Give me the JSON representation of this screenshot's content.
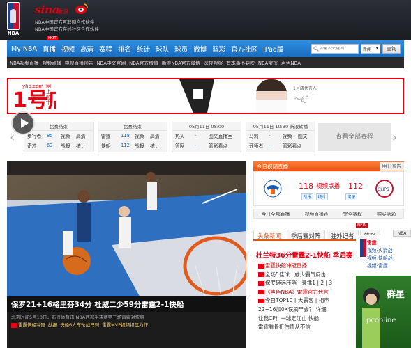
{
  "header": {
    "nba_word": "NBA",
    "sina": "sina",
    "sina_sub": "新浪",
    "partner_line1": "NBA中国官方互联网合作伙伴",
    "partner_line2": "NBA中国官方在线社区合作伙伴",
    "nav_hot": "HOT",
    "nav": [
      "My NBA",
      "直播",
      "视频",
      "高清",
      "赛程",
      "排名",
      "统计",
      "球队",
      "球员",
      "微博",
      "篮彩",
      "官方社区",
      "iPad版"
    ],
    "search_placeholder": "请输入关键词",
    "search_select": "新闻",
    "search_button": "查询",
    "subnav": [
      "NBA视频直播",
      "视频点播",
      "电视直播预告",
      "NBA中文官网",
      "NBA官方增值",
      "新浪NBA官方微博",
      "深夜视察",
      "有本事不要吹",
      "NBA宝探",
      "声色NBA"
    ]
  },
  "banner": {
    "yhd_url": "yhd.com",
    "yhd_cn1": "1号店",
    "yhd_tag": "网上超市",
    "spokes_label": "1号店代言人"
  },
  "schedule": {
    "games": [
      {
        "head": "比赛结束",
        "rows": [
          [
            "步行者",
            "85",
            "视频",
            "高清"
          ],
          [
            "奇才",
            "63",
            "战报",
            "统计"
          ]
        ]
      },
      {
        "head": "比赛结束",
        "rows": [
          [
            "雷霆",
            "118",
            "视频",
            "高清"
          ],
          [
            "快船",
            "112",
            "战报",
            "统计"
          ]
        ]
      },
      {
        "head": "05月11日 08:00",
        "rows": [
          [
            "热火",
            "-",
            "图文直播室",
            ""
          ],
          [
            "篮网",
            "-",
            "篮彩看点",
            ""
          ]
        ]
      },
      {
        "head": "05月11日 10:30 新浪转播",
        "rows": [
          [
            "马刺",
            "-",
            "视频",
            "图文"
          ],
          [
            "开拓者",
            "-",
            "篮彩看点",
            ""
          ]
        ]
      }
    ],
    "all_button": "查看全部赛程"
  },
  "photo": {
    "caption": "保罗21+16格里芬34分 杜威二少59分雷霆2-1快船",
    "sub1": "北京时间5月10日，新浪体育讯 NBA西部半决赛第三场雷霆对快船",
    "links": [
      "雷霆快船冲冠",
      "战报",
      "快船6人车轮战马刺",
      "雷霆MVP视频扣篮力作"
    ]
  },
  "live": {
    "title": "今日视频直播",
    "tomorrow": "明日预告",
    "score_left": "118",
    "center": "视频点播",
    "score_right": "112",
    "btn1": "战报",
    "btn2": "统计",
    "btn3": "实录",
    "links": [
      "今日全部直播",
      "视频直播表",
      "完全赛程",
      "购买篮彩"
    ]
  },
  "tabs": [
    "头条新闻",
    "季后赛对阵",
    "驻外记者",
    "篮彩"
  ],
  "new_tag": "NEW",
  "news": {
    "headline": "杜兰特36分雷霆2-1快船 季后赛",
    "items": [
      {
        "t": "雷霆快船冲冠直播",
        "c": "red"
      },
      {
        "t": "全场5佳球 | 威少霸气反击",
        "c": ""
      },
      {
        "t": "保罗砸远压哨 | 录播1 | 2 | 3",
        "c": ""
      },
      {
        "t": "《声色NBA》雷霆官方代言",
        "c": "red"
      },
      {
        "t": "今日TOP10 | 大霸客 | 相声",
        "c": ""
      },
      {
        "t": "22+16加0X误刷早会？ 详细",
        "c": ""
      },
      {
        "t": "让我CP！一球定江山 快船",
        "c": ""
      },
      {
        "t": "雷霆看骨折伤情从不信",
        "c": ""
      }
    ]
  },
  "ad": {
    "tab": "NBA",
    "lines": [
      "雷霆",
      "快船",
      "雷霆",
      "VS"
    ],
    "links": [
      "视频-火箭战",
      "视频-快船战",
      "视频-雷霆"
    ],
    "group": "群星",
    "watermark": "pconline"
  }
}
